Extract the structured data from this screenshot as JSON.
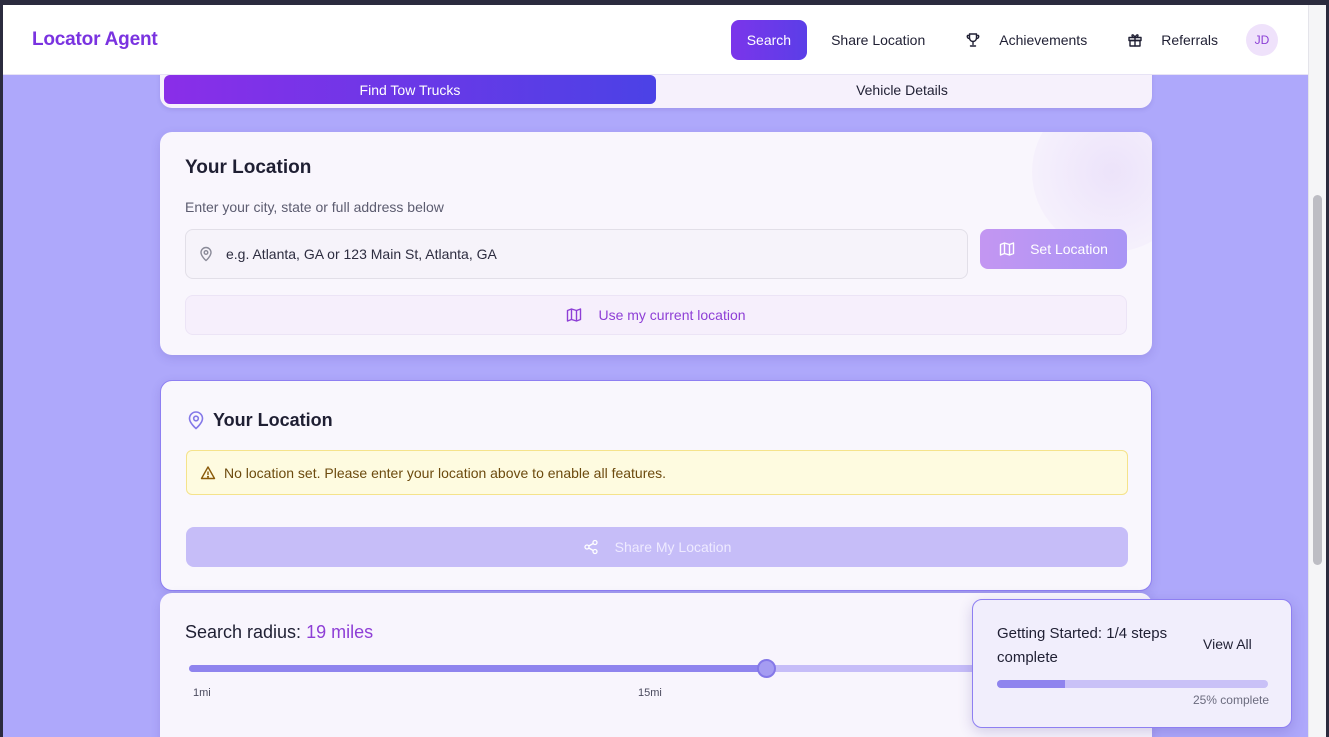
{
  "app": {
    "title": "Locator Agent"
  },
  "nav": {
    "items": [
      {
        "label": "Search",
        "active": true
      },
      {
        "label": "Share Location",
        "active": false
      },
      {
        "label": "Achievements",
        "icon": "trophy-icon",
        "active": false
      },
      {
        "label": "Referrals",
        "icon": "gift-icon",
        "active": false
      }
    ],
    "avatar_initials": "JD"
  },
  "tabs": [
    {
      "label": "Find Tow Trucks",
      "active": true
    },
    {
      "label": "Vehicle Details",
      "active": false
    }
  ],
  "location_card": {
    "title": "Your Location",
    "subtitle": "Enter your city, state or full address below",
    "input": {
      "value": "",
      "placeholder": "e.g. Atlanta, GA or 123 Main St, Atlanta, GA"
    },
    "set_button": "Set Location",
    "current_location_button": "Use my current location"
  },
  "status_card": {
    "title": "Your Location",
    "warning": "No location set. Please enter your location above to enable all features.",
    "share_button": "Share My Location"
  },
  "radius": {
    "label": "Search radius:",
    "value_text": "19 miles",
    "value": 19,
    "min": 1,
    "ticks": [
      "1mi",
      "15mi"
    ],
    "slider_fraction": 0.615
  },
  "getting_started": {
    "title": "Getting Started: 1/4 steps complete",
    "view_all": "View All",
    "progress": 0.25,
    "progress_text": "25% complete"
  },
  "colors": {
    "brand": "#7a33e0",
    "background": "#aea8fb",
    "warning_bg": "#fefbe0"
  }
}
